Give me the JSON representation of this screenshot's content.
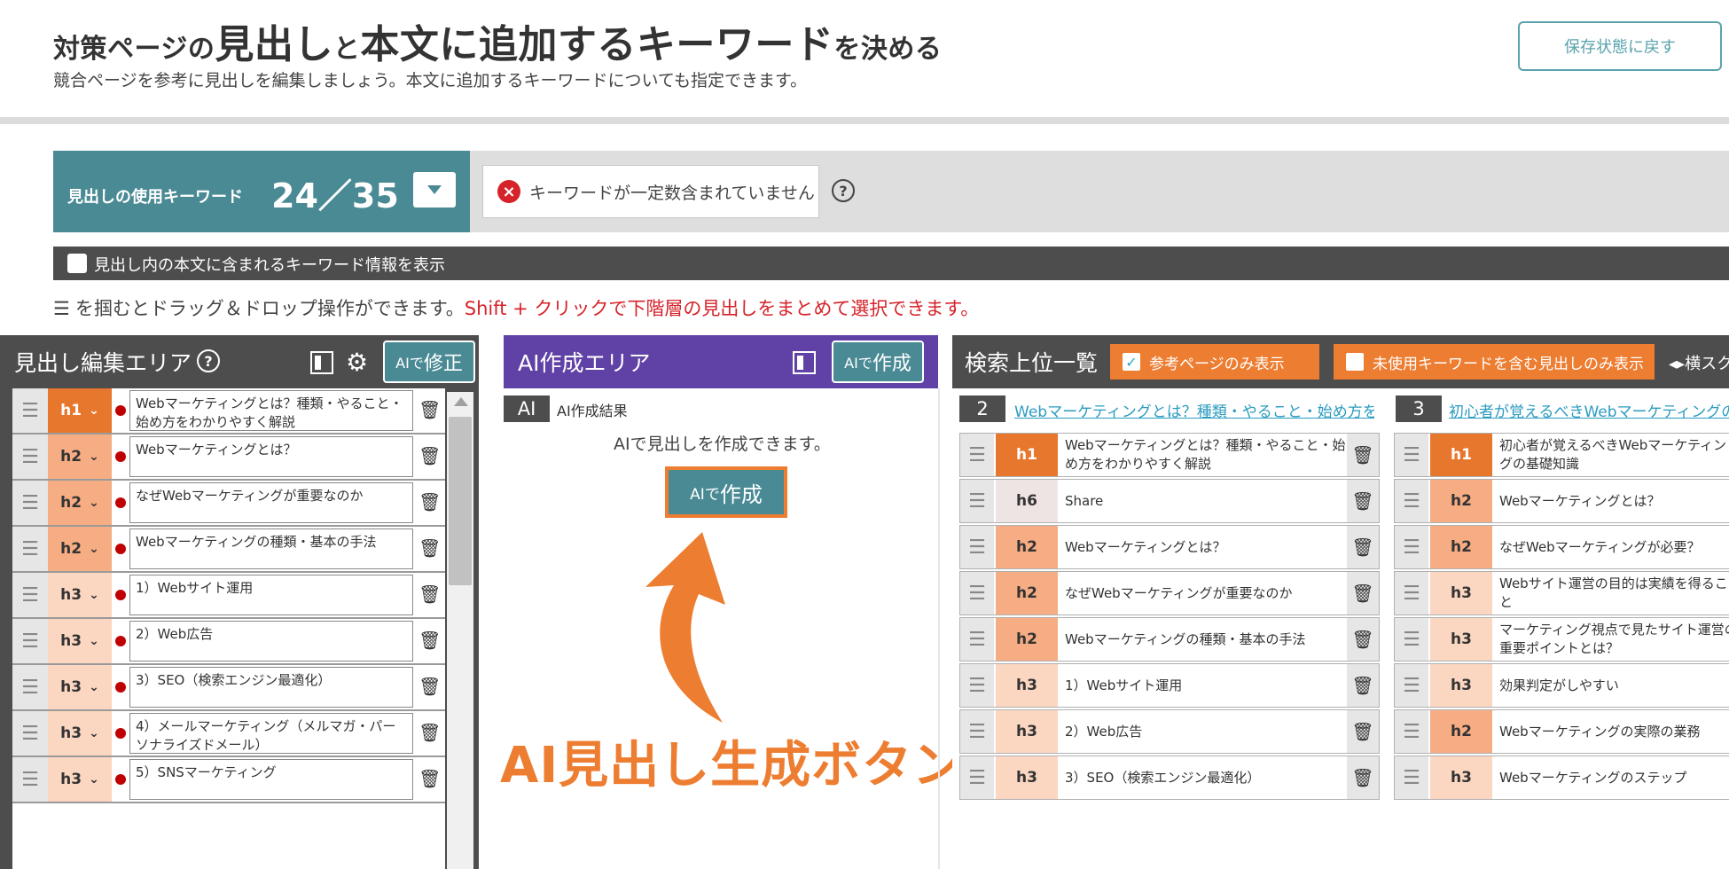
{
  "header": {
    "title_parts": [
      "対策ページの",
      "見出し",
      "と",
      "本文に追加するキーワード",
      "を決める"
    ],
    "subtitle": "競合ページを参考に見出しを編集しましょう。本文に追加するキーワードについても指定できます。",
    "restore_button": "保存状態に戻す"
  },
  "keyword_bar": {
    "label": "見出しの使用キーワード",
    "count": "24／35",
    "warning": "キーワードが一定数含まれていません",
    "help": "?"
  },
  "toggle_bar": {
    "label": "見出し内の本文に含まれるキーワード情報を表示"
  },
  "hint": {
    "prefix": "を掴むとドラッグ＆ドロップ操作ができます。",
    "red": "Shift + クリックで下階層の見出しをまとめて選択できます。"
  },
  "left_panel": {
    "title": "見出し編集エリア",
    "ai_fix_prefix": "AIで",
    "ai_fix_label": "修正",
    "rows": [
      {
        "level": "h1",
        "text": "Webマーケティングとは？種類・やること・始め方をわかりやすく解説"
      },
      {
        "level": "h2",
        "text": "Webマーケティングとは？"
      },
      {
        "level": "h2",
        "text": "なぜWebマーケティングが重要なのか"
      },
      {
        "level": "h2",
        "text": "Webマーケティングの種類・基本の手法"
      },
      {
        "level": "h3",
        "text": "1）Webサイト運用"
      },
      {
        "level": "h3",
        "text": "2）Web広告"
      },
      {
        "level": "h3",
        "text": "3）SEO（検索エンジン最適化）"
      },
      {
        "level": "h3",
        "text": "4）メールマーケティング（メルマガ・パーソナライズドメール）"
      },
      {
        "level": "h3",
        "text": "5）SNSマーケティング"
      }
    ]
  },
  "middle_panel": {
    "title": "AI作成エリア",
    "ai_create_prefix": "AIで",
    "ai_create_label": "作成",
    "ai_badge": "AI",
    "ai_result": "AI作成結果",
    "description": "AIで見出しを作成できます。",
    "create_prefix": "AIで",
    "create_label": "作成",
    "callout": "AI見出し生成ボタン"
  },
  "right_panel": {
    "title": "検索上位一覧",
    "opt_reference_only": "参考ページのみ表示",
    "opt_unused_keywords": "未使用キーワードを含む見出しのみ表示",
    "scroll_label": "横スク",
    "columns": [
      {
        "rank": "2",
        "link": "Webマーケティングとは？種類・やること・始め方を",
        "rows": [
          {
            "level": "h1",
            "text": "Webマーケティングとは？種類・やること・始め方をわかりやすく解説"
          },
          {
            "level": "h6",
            "text": "Share"
          },
          {
            "level": "h2",
            "text": "Webマーケティングとは？"
          },
          {
            "level": "h2",
            "text": "なぜWebマーケティングが重要なのか"
          },
          {
            "level": "h2",
            "text": "Webマーケティングの種類・基本の手法"
          },
          {
            "level": "h3",
            "text": "1）Webサイト運用"
          },
          {
            "level": "h3",
            "text": "2）Web広告"
          },
          {
            "level": "h3",
            "text": "3）SEO（検索エンジン最適化）"
          }
        ]
      },
      {
        "rank": "3",
        "link": "初心者が覚えるべきWebマーケティングの",
        "rows": [
          {
            "level": "h1",
            "text": "初心者が覚えるべきWebマーケティングの基礎知識"
          },
          {
            "level": "h2",
            "text": "Webマーケティングとは？"
          },
          {
            "level": "h2",
            "text": "なぜWebマーケティングが必要？"
          },
          {
            "level": "h3",
            "text": "Webサイト運営の目的は実績を得ること"
          },
          {
            "level": "h3",
            "text": "マーケティング視点で見たサイト運営の重要ポイントとは？"
          },
          {
            "level": "h3",
            "text": "効果判定がしやすい"
          },
          {
            "level": "h2",
            "text": "Webマーケティングの実際の業務"
          },
          {
            "level": "h3",
            "text": "Webマーケティングのステップ"
          }
        ]
      }
    ]
  },
  "colors": {
    "teal": "#4a8a95",
    "purple": "#6042a6",
    "orange": "#ed7d31",
    "h1": "#e8772e",
    "h2": "#f6ad83",
    "h3": "#fbd6c1",
    "h6": "#efe4e4",
    "error_red": "#d6232a"
  },
  "icons": [
    "gear-icon",
    "trash-icon",
    "drag-handle-icon",
    "help-icon",
    "layout-toggle-icon",
    "chevron-down-icon",
    "error-icon",
    "check-icon",
    "arrow-icon"
  ]
}
